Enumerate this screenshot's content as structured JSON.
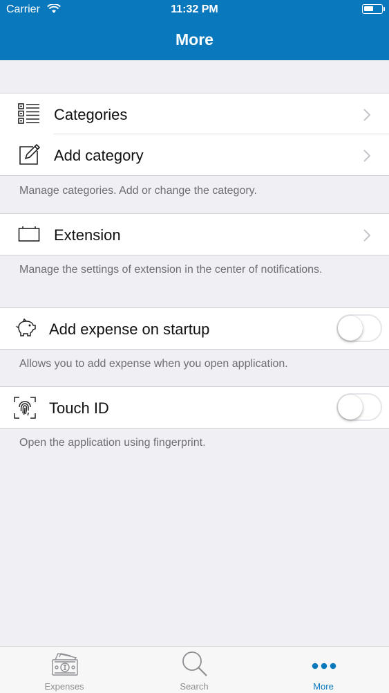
{
  "status_bar": {
    "carrier": "Carrier",
    "time": "11:32 PM"
  },
  "header": {
    "title": "More"
  },
  "groups": {
    "categories": {
      "rows": [
        {
          "label": "Categories",
          "icon": "list-icon"
        },
        {
          "label": "Add category",
          "icon": "edit-icon"
        }
      ],
      "footer": "Manage categories. Add or change the category."
    },
    "extension": {
      "rows": [
        {
          "label": "Extension",
          "icon": "widget-icon"
        }
      ],
      "footer": "Manage the settings of extension in the center of notifications."
    },
    "startup": {
      "rows": [
        {
          "label": "Add expense on startup",
          "icon": "piggy-bank-icon",
          "toggle_on": false
        }
      ],
      "footer": "Allows you to add expense when you open application."
    },
    "touch_id": {
      "rows": [
        {
          "label": "Touch ID",
          "icon": "fingerprint-icon",
          "toggle_on": false
        }
      ],
      "footer": "Open the application using fingerprint."
    }
  },
  "tab_bar": {
    "tabs": [
      {
        "label": "Expenses",
        "icon": "money-icon",
        "active": false
      },
      {
        "label": "Search",
        "icon": "magnifier-icon",
        "active": false
      },
      {
        "label": "More",
        "icon": "more-dots-icon",
        "active": true
      }
    ]
  },
  "colors": {
    "accent": "#0a78bd",
    "background": "#efeff4",
    "footer_text": "#6d6d72"
  }
}
